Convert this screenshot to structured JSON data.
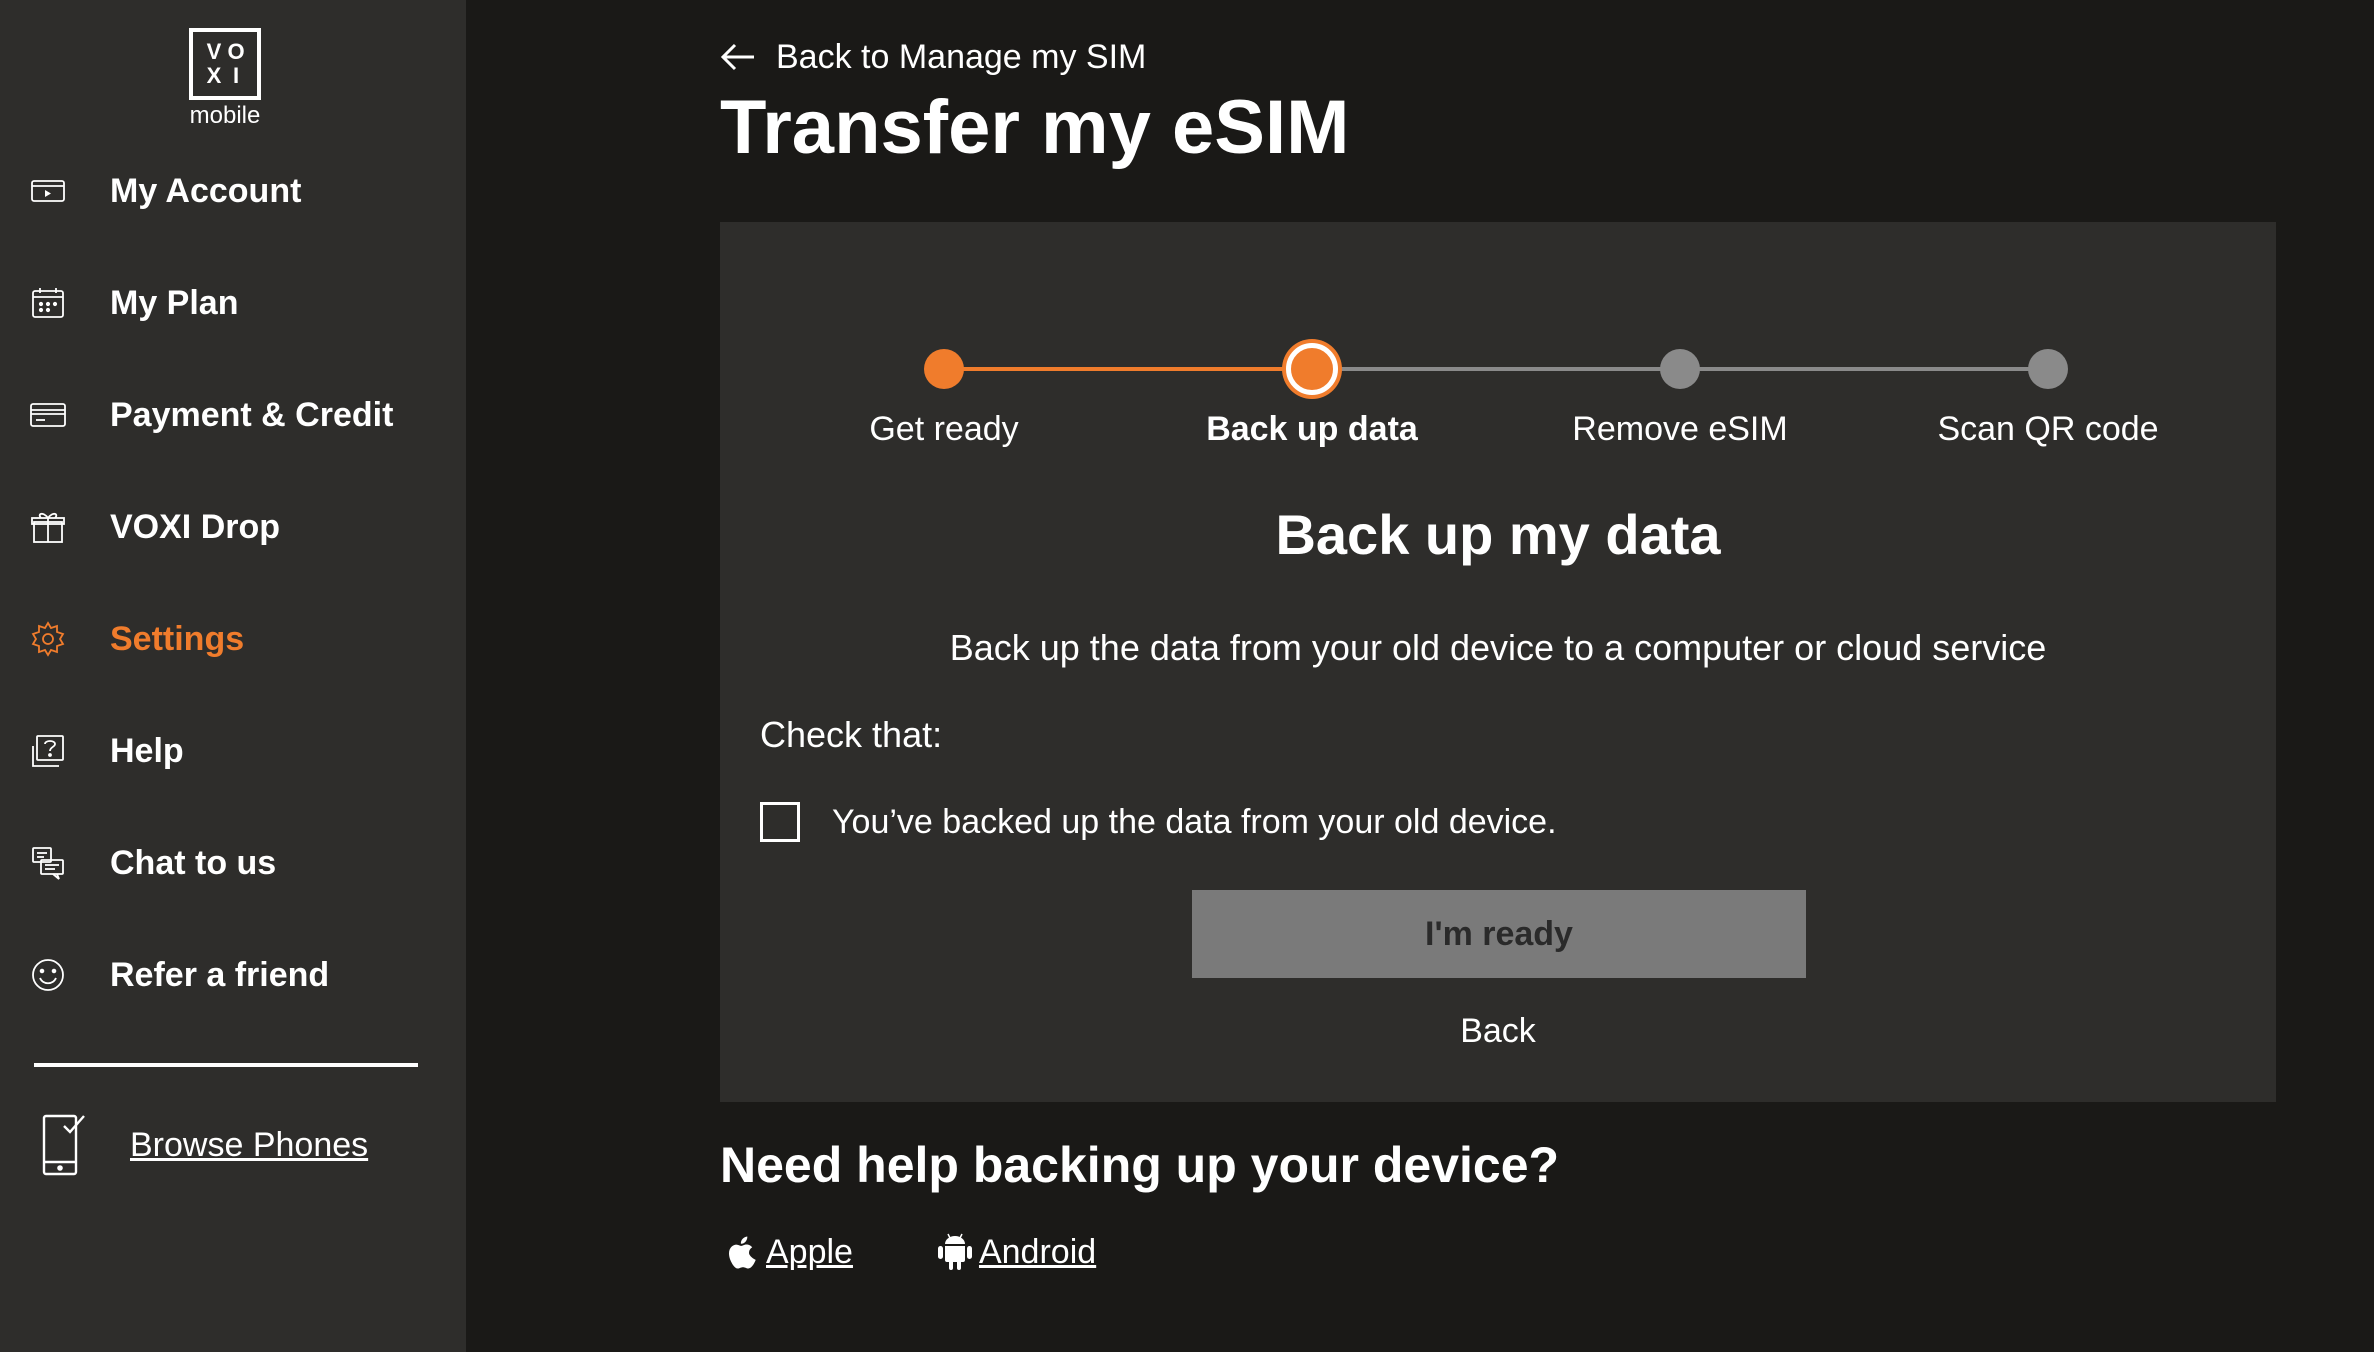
{
  "logo": {
    "letters": [
      "V",
      "O",
      "X",
      "I"
    ],
    "sub": "mobile"
  },
  "sidebar": {
    "items": [
      {
        "label": "My Account",
        "icon": "account-card-icon",
        "active": false
      },
      {
        "label": "My Plan",
        "icon": "calendar-icon",
        "active": false
      },
      {
        "label": "Payment & Credit",
        "icon": "credit-card-icon",
        "active": false
      },
      {
        "label": "VOXI Drop",
        "icon": "gift-icon",
        "active": false
      },
      {
        "label": "Settings",
        "icon": "gear-icon",
        "active": true
      },
      {
        "label": "Help",
        "icon": "help-icon",
        "active": false
      },
      {
        "label": "Chat to us",
        "icon": "chat-icon",
        "active": false
      },
      {
        "label": "Refer a friend",
        "icon": "smiley-icon",
        "active": false
      }
    ],
    "browse_label": "Browse Phones"
  },
  "header": {
    "back_label": "Back to Manage my SIM",
    "title": "Transfer my eSIM"
  },
  "stepper": {
    "steps": [
      {
        "label": "Get ready",
        "state": "done"
      },
      {
        "label": "Back up data",
        "state": "current"
      },
      {
        "label": "Remove eSIM",
        "state": "pending"
      },
      {
        "label": "Scan QR code",
        "state": "pending"
      }
    ]
  },
  "content": {
    "title": "Back up my data",
    "description": "Back up the data from your old device to a computer or cloud service",
    "check_heading": "Check that:",
    "checkbox_label": "You’ve backed up the data from your old device.",
    "checkbox_checked": false,
    "ready_button": "I'm ready",
    "back_button": "Back"
  },
  "help": {
    "title": "Need help backing up your device?",
    "apple_label": "Apple",
    "android_label": "Android"
  },
  "colors": {
    "accent": "#f07c2c",
    "sidebar_bg": "#2e2d2b",
    "page_bg": "#1a1917",
    "pending": "#8a8a8a"
  }
}
